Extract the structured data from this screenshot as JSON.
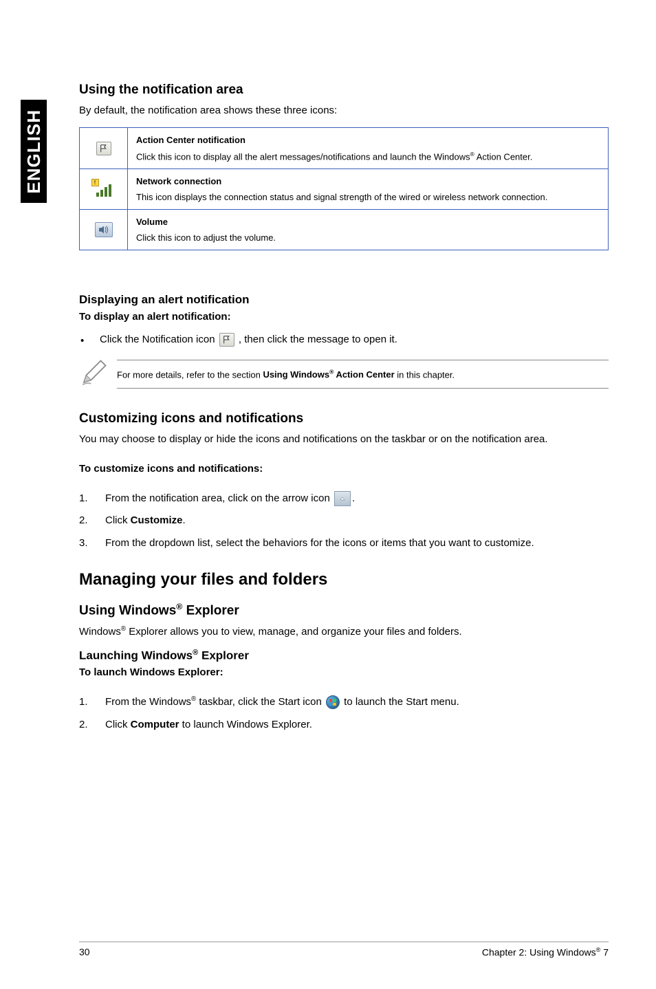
{
  "sideTab": "ENGLISH",
  "section1": {
    "title": "Using the notification area",
    "intro": "By default, the notification area shows these three icons:",
    "rows": [
      {
        "title": "Action Center notification",
        "desc_a": "Click this icon to display all the alert messages/notifications and launch the Windows",
        "desc_b": " Action Center."
      },
      {
        "title": "Network connection",
        "desc": "This icon displays the connection status and signal strength of the wired or wireless network connection."
      },
      {
        "title": "Volume",
        "desc": "Click this icon to adjust the volume."
      }
    ]
  },
  "section2": {
    "title": "Displaying an alert notification",
    "bold": "To display an alert notification:",
    "bullet_a": "Click the Notification icon ",
    "bullet_b": ", then click the message to open it."
  },
  "note": {
    "text_a": "For more details, refer to the section ",
    "text_b": "Using Windows",
    "text_c": " Action Center",
    "text_d": " in this chapter."
  },
  "section3": {
    "title": "Customizing icons and notifications",
    "intro": "You may choose to display or hide the icons and notifications on the taskbar or on the notification area.",
    "bold": "To customize icons and notifications:",
    "step1": "From the notification area, click on the arrow icon ",
    "step1_end": ".",
    "step2_a": "Click ",
    "step2_b": "Customize",
    "step2_c": ".",
    "step3": "From the dropdown list, select the behaviors for the icons or items that you want to customize."
  },
  "mainHeading": "Managing your files and folders",
  "section4": {
    "title_a": "Using Windows",
    "title_b": " Explorer",
    "intro_a": "Windows",
    "intro_b": " Explorer allows you to view, manage, and organize your files and folders.",
    "sub_a": "Launching Windows",
    "sub_b": " Explorer",
    "bold": "To launch Windows Explorer:",
    "step1_a": "From the Windows",
    "step1_b": " taskbar, click the Start icon ",
    "step1_c": " to launch the Start menu.",
    "step2_a": "Click ",
    "step2_b": "Computer",
    "step2_c": " to launch Windows Explorer."
  },
  "footer": {
    "page": "30",
    "chapter_a": "Chapter 2: Using Windows",
    "chapter_b": " 7"
  }
}
